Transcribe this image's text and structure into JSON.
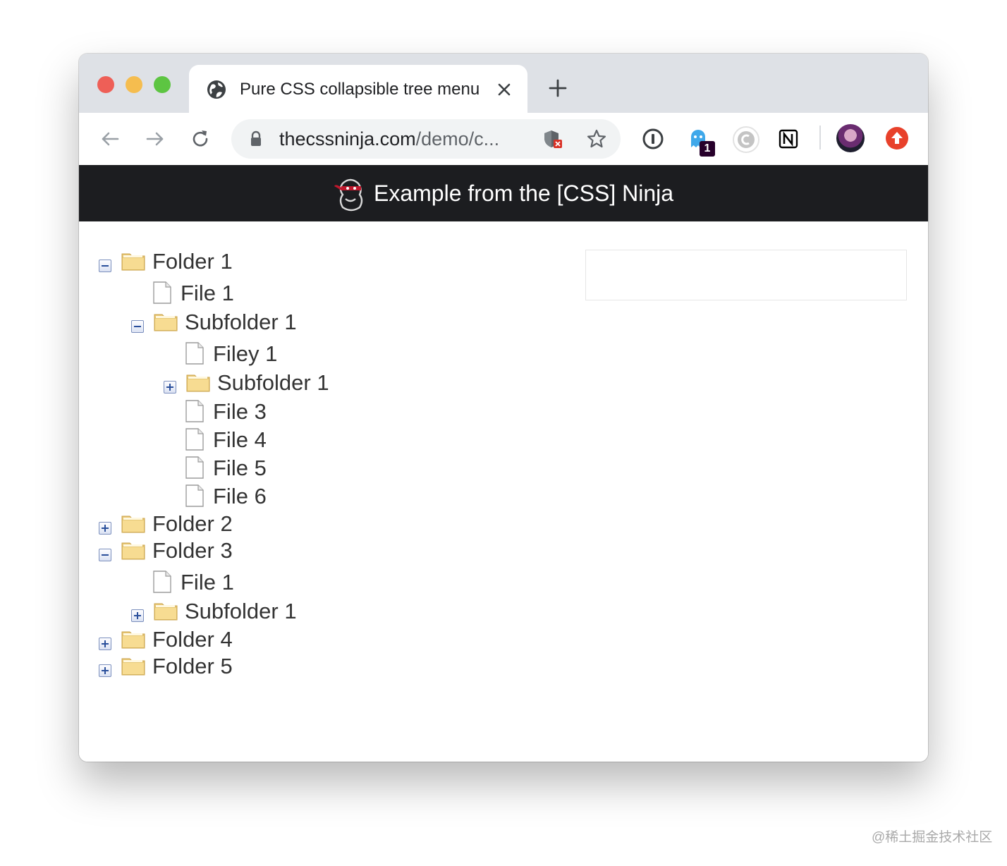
{
  "browser": {
    "tab": {
      "title": "Pure CSS collapsible tree menu | ",
      "icon": "globe-icon"
    },
    "address": {
      "host": "thecssninja.com",
      "path": "/demo/c..."
    },
    "extensions": {
      "ghost_badge": "1"
    }
  },
  "page": {
    "header_title": "Example from the [CSS] Ninja",
    "tree": [
      {
        "type": "folder",
        "label": "Folder 1",
        "toggle": "expanded",
        "level": 0
      },
      {
        "type": "file",
        "label": "File 1",
        "level": 1
      },
      {
        "type": "folder",
        "label": "Subfolder 1",
        "toggle": "expanded",
        "level": 1
      },
      {
        "type": "file",
        "label": "Filey 1",
        "level": 2
      },
      {
        "type": "folder",
        "label": "Subfolder 1",
        "toggle": "collapsed",
        "level": 2
      },
      {
        "type": "file",
        "label": "File 3",
        "level": 2
      },
      {
        "type": "file",
        "label": "File 4",
        "level": 2
      },
      {
        "type": "file",
        "label": "File 5",
        "level": 2
      },
      {
        "type": "file",
        "label": "File 6",
        "level": 2
      },
      {
        "type": "folder",
        "label": "Folder 2",
        "toggle": "collapsed",
        "level": 0
      },
      {
        "type": "folder",
        "label": "Folder 3",
        "toggle": "expanded",
        "level": 0
      },
      {
        "type": "file",
        "label": "File 1",
        "level": 1
      },
      {
        "type": "folder",
        "label": "Subfolder 1",
        "toggle": "collapsed",
        "level": 1
      },
      {
        "type": "folder",
        "label": "Folder 4",
        "toggle": "collapsed",
        "level": 0
      },
      {
        "type": "folder",
        "label": "Folder 5",
        "toggle": "collapsed",
        "level": 0
      }
    ]
  },
  "watermark": "@稀土掘金技术社区"
}
